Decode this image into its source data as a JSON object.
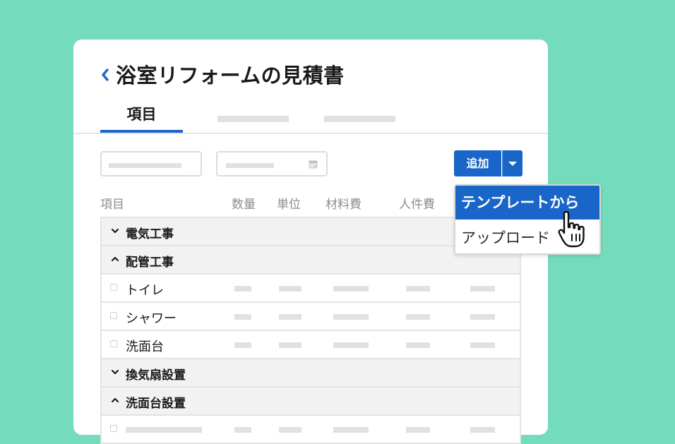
{
  "page": {
    "title": "浴室リフォームの見積書",
    "back_icon": "chevron-left-icon"
  },
  "tabs": {
    "active_label": "項目"
  },
  "toolbar": {
    "add_label": "追加",
    "dropdown_icon": "caret-down-icon",
    "calendar_icon": "calendar-icon"
  },
  "columns": {
    "item": "項目",
    "quantity": "数量",
    "unit": "単位",
    "material_cost": "材料費",
    "labor_cost": "人件費"
  },
  "table": {
    "groups": [
      {
        "label": "電気工事",
        "expanded": false,
        "icon": "chevron-down-icon"
      },
      {
        "label": "配管工事",
        "expanded": true,
        "icon": "chevron-up-icon",
        "items": [
          "トイレ",
          "シャワー",
          "洗面台"
        ]
      },
      {
        "label": "換気扇設置",
        "expanded": false,
        "icon": "chevron-down-icon"
      },
      {
        "label": "洗面台設置",
        "expanded": true,
        "icon": "chevron-up-icon"
      }
    ]
  },
  "dropdown": {
    "items": [
      "テンプレートから",
      "アップロード"
    ],
    "highlighted_index": 0
  },
  "colors": {
    "background": "#74dcbc",
    "accent": "#1a66c8",
    "card": "#ffffff"
  },
  "cursor_icon": "hand-pointer-icon"
}
